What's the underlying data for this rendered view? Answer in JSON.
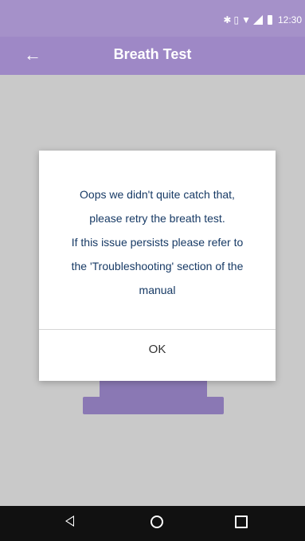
{
  "status_bar": {
    "time": "12:30",
    "icons": [
      "bluetooth-icon",
      "vibrate-icon",
      "wifi-icon",
      "signal-icon",
      "battery-icon"
    ]
  },
  "app_bar": {
    "title": "Breath Test",
    "back_icon": "back-arrow-icon"
  },
  "dialog": {
    "message_lines": [
      "Oops we didn't quite catch that,",
      "please retry the breath test.",
      "If this issue persists please refer to",
      "the 'Troubleshooting' section of the",
      "manual"
    ],
    "ok_label": "OK"
  },
  "nav_bar": {
    "icons": [
      "back-icon",
      "home-icon",
      "recents-icon"
    ]
  },
  "colors": {
    "status_bar": "#a591c9",
    "app_bar": "#9e88c6",
    "text": "#173a65"
  }
}
